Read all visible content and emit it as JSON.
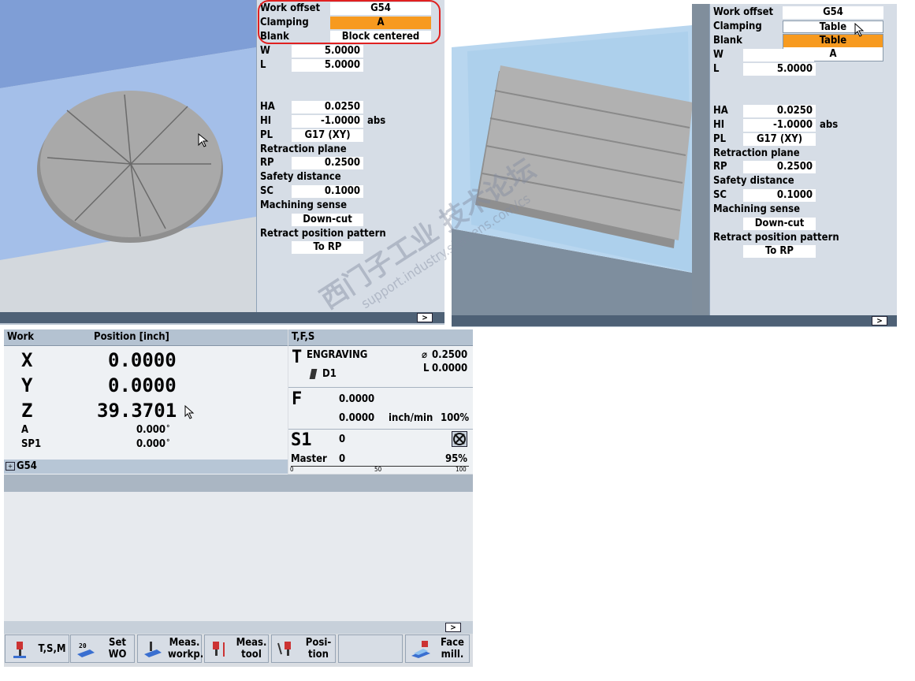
{
  "panel_left": {
    "labels": {
      "work_offset": "Work offset",
      "clamping": "Clamping",
      "blank": "Blank",
      "w": "W",
      "l": "L",
      "ha": "HA",
      "hi": "HI",
      "pl": "PL",
      "retraction_plane": "Retraction plane",
      "rp": "RP",
      "safety_distance": "Safety distance",
      "sc": "SC",
      "machining_sense": "Machining sense",
      "retract_pattern": "Retract position pattern"
    },
    "values": {
      "work_offset": "G54",
      "clamping": "A",
      "blank": "Block centered",
      "w": "5.0000",
      "l": "5.0000",
      "ha": "0.0250",
      "hi": "-1.0000",
      "hi_unit": "abs",
      "pl": "G17 (XY)",
      "rp": "0.2500",
      "sc": "0.1000",
      "machining_sense": "Down-cut",
      "retract_pattern": "To RP"
    },
    "scroll_arrow": ">"
  },
  "panel_right": {
    "labels": {
      "work_offset": "Work offset",
      "clamping": "Clamping",
      "blank": "Blank",
      "w": "W",
      "l": "L",
      "ha": "HA",
      "hi": "HI",
      "pl": "PL",
      "retraction_plane": "Retraction plane",
      "rp": "RP",
      "safety_distance": "Safety distance",
      "sc": "SC",
      "machining_sense": "Machining sense",
      "retract_pattern": "Retract position pattern"
    },
    "values": {
      "work_offset": "G54",
      "clamping": "Table",
      "l": "5.0000",
      "ha": "0.0250",
      "hi": "-1.0000",
      "hi_unit": "abs",
      "pl": "G17 (XY)",
      "rp": "0.2500",
      "sc": "0.1000",
      "machining_sense": "Down-cut",
      "retract_pattern": "To RP"
    },
    "dropdown_options": [
      "Table",
      "A"
    ],
    "dropdown_selected": "Table",
    "scroll_arrow": ">"
  },
  "machine": {
    "header": {
      "work": "Work",
      "position": "Position [inch]",
      "tfs": "T,F,S"
    },
    "axes": [
      {
        "name": "X",
        "value": "0.0000"
      },
      {
        "name": "Y",
        "value": "0.0000"
      },
      {
        "name": "Z",
        "value": "39.3701"
      }
    ],
    "small_axes": [
      {
        "name": "A",
        "value": "0.000",
        "unit": "°"
      },
      {
        "name": "SP1",
        "value": "0.000",
        "unit": "°"
      }
    ],
    "work_offset": "G54",
    "tool": {
      "letter": "T",
      "name": "ENGRAVING",
      "diameter_symbol": "⌀",
      "diameter": "0.2500",
      "length_label": "L",
      "length": "0.0000",
      "edge": "D1"
    },
    "feed": {
      "letter": "F",
      "value1": "0.0000",
      "value2": "0.0000",
      "unit": "inch/min",
      "override": "100%"
    },
    "spindle": {
      "letter": "S1",
      "value": "0",
      "master_label": "Master",
      "master_value": "0",
      "override": "95%",
      "scale": [
        "0",
        "50",
        "100"
      ]
    },
    "scroll_arrow": ">"
  },
  "softkeys": [
    {
      "label": "T,S,M",
      "icon": "tool-spindle-icon"
    },
    {
      "label": "Set WO",
      "icon": "set-wo-icon"
    },
    {
      "label": "Meas. workp.",
      "icon": "measure-workpiece-icon"
    },
    {
      "label": "Meas. tool",
      "icon": "measure-tool-icon"
    },
    {
      "label": "Posi- tion",
      "icon": "position-icon"
    },
    {
      "label": "",
      "icon": ""
    },
    {
      "label": "Face mill.",
      "icon": "face-mill-icon"
    }
  ],
  "watermark": {
    "line1": "西门子工业 技术论坛",
    "line2": "support.industry.siemens.com/cs"
  },
  "colors": {
    "highlight": "#f79a1f",
    "panel_bg": "#d6dde6",
    "circle_annotation": "#e02020"
  }
}
